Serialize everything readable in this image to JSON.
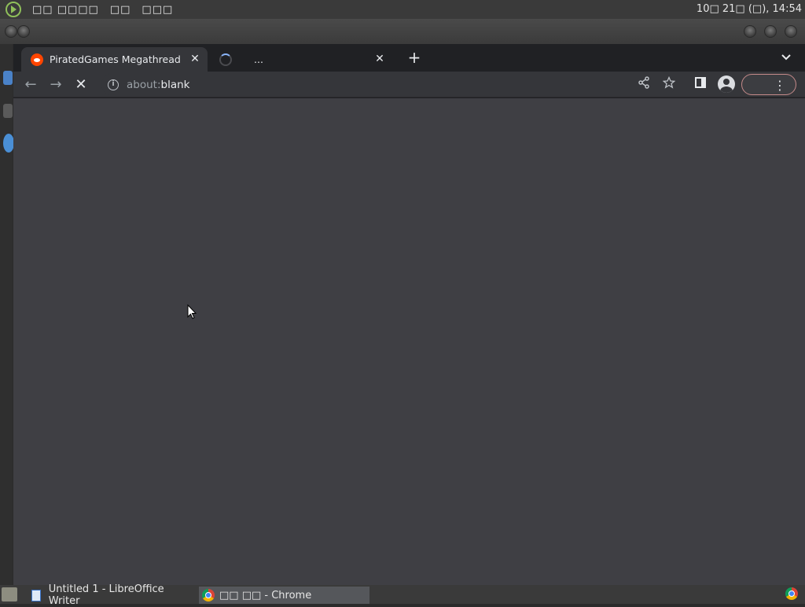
{
  "top_panel": {
    "menu": [
      "□□ □□□□",
      "□□",
      "□□□"
    ],
    "clock": "10□ 21□ (□), 14:54"
  },
  "browser": {
    "tabs": [
      {
        "title": "PiratedGames Megathread : r/",
        "state": "loaded",
        "favicon": "reddit-icon"
      },
      {
        "title": "...",
        "state": "loading",
        "favicon": "loading-spinner-icon"
      }
    ],
    "new_tab_symbol": "+",
    "tab_search_symbol": "⌄",
    "toolbar": {
      "back": "←",
      "forward": "→",
      "stop": "✕"
    },
    "omnibox": {
      "url_prefix": "about:",
      "url_host": "blank"
    },
    "page_background": "#3f3f44"
  },
  "taskbar": {
    "tasks": [
      {
        "label": "Untitled 1 - LibreOffice Writer",
        "icon": "writer-doc-icon"
      },
      {
        "label": "□□ □□ - Chrome",
        "icon": "chrome-icon",
        "active": true
      }
    ]
  }
}
